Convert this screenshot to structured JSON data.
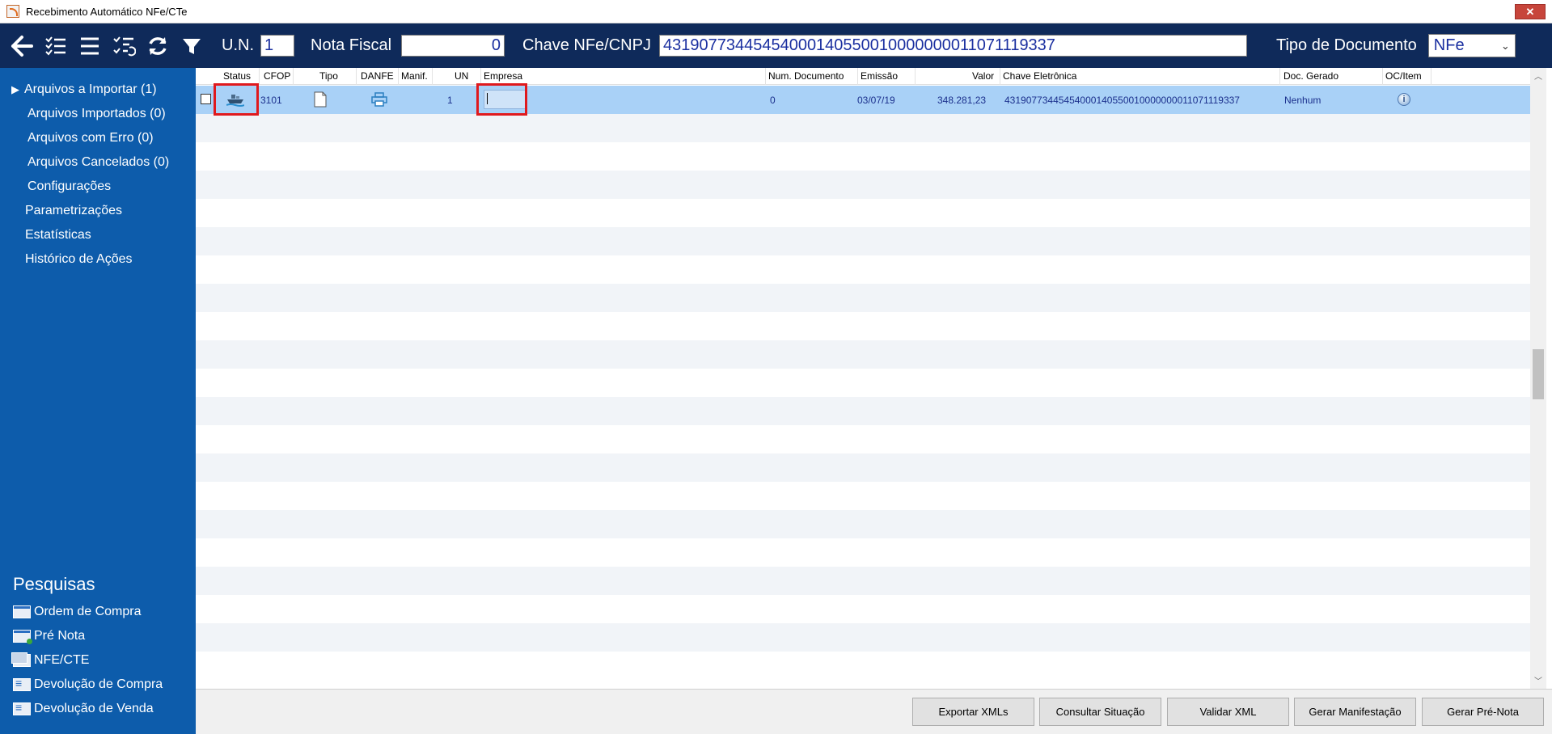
{
  "window": {
    "title": "Recebimento Automático NFe/CTe",
    "close_label": "✕"
  },
  "toolbar": {
    "icons": [
      "back-arrow-icon",
      "checklist-icon",
      "list-icon",
      "checklist-refresh-icon",
      "refresh-icon",
      "filter-icon"
    ],
    "un_label": "U.N.",
    "un_value": "1",
    "nota_label": "Nota Fiscal",
    "nota_value": "0",
    "chave_label": "Chave NFe/CNPJ",
    "chave_value": "43190773445454000140550010000000011071119337",
    "tipo_label": "Tipo de Documento",
    "tipo_value": "NFe"
  },
  "sidebar": {
    "items": [
      {
        "label": "Arquivos a Importar (1)",
        "expanded_marker": "▶"
      },
      {
        "label": "Arquivos Importados (0)"
      },
      {
        "label": "Arquivos com Erro (0)"
      },
      {
        "label": "Arquivos Cancelados (0)"
      },
      {
        "label": "Configurações"
      },
      {
        "label": "Parametrizações"
      },
      {
        "label": "Estatísticas"
      },
      {
        "label": "Histórico de Ações"
      }
    ],
    "pesquisas_title": "Pesquisas",
    "pesquisas": [
      {
        "label": "Ordem de Compra"
      },
      {
        "label": "Pré Nota"
      },
      {
        "label": "NFE/CTE"
      },
      {
        "label": "Devolução de Compra"
      },
      {
        "label": "Devolução de Venda"
      }
    ]
  },
  "grid": {
    "headers": [
      "Status",
      "CFOP",
      "Tipo",
      "DANFE",
      "Manif.",
      "UN",
      "Empresa",
      "Num. Documento",
      "Emissão",
      "Valor",
      "Chave Eletrônica",
      "Doc. Gerado",
      "OC/Item"
    ],
    "rows": [
      {
        "cfop": "3101",
        "un": "1",
        "num_documento": "0",
        "emissao": "03/07/19",
        "valor": "348.281,23",
        "chave": "43190773445454000140550010000000011071119337",
        "doc_gerado": "Nenhum",
        "oc_item_icon": "i"
      }
    ]
  },
  "buttons": {
    "exportar": "Exportar XMLs",
    "consultar": "Consultar Situação",
    "validar": "Validar XML",
    "manifestacao": "Gerar Manifestação",
    "pre_nota": "Gerar Pré-Nota"
  },
  "colors": {
    "toolbar_bg": "#0f2a5a",
    "sidebar_bg": "#0d5cab",
    "selected_row": "#a9d1f7",
    "highlight_red": "#e0191d"
  }
}
